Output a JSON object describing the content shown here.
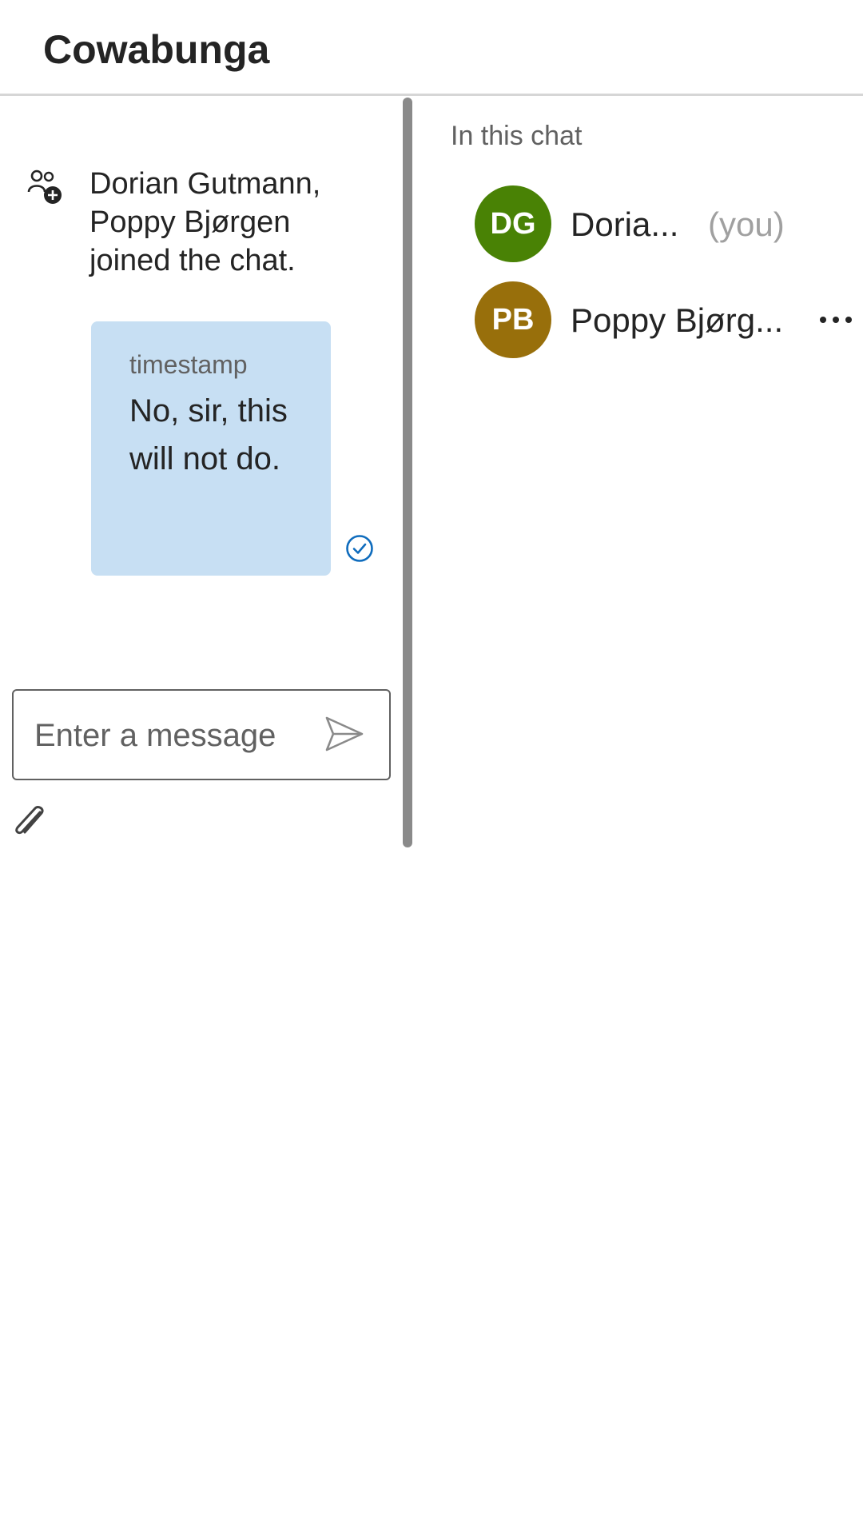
{
  "header": {
    "title": "Cowabunga"
  },
  "chat": {
    "system_message": "Dorian Gutmann, Poppy Bjørgen joined the chat.",
    "messages": [
      {
        "timestamp": "timestamp",
        "text": "No, sir, this will not do.",
        "status": "read"
      }
    ],
    "composer": {
      "placeholder": "Enter a message",
      "value": ""
    }
  },
  "people": {
    "heading": "In this chat",
    "members": [
      {
        "initials": "DG",
        "name": "Doria...",
        "suffix": "(you)",
        "avatar_color": "#498205"
      },
      {
        "initials": "PB",
        "name": "Poppy Bjørg...",
        "suffix": "",
        "avatar_color": "#986f0b"
      }
    ]
  },
  "colors": {
    "bubble": "#c7dff3",
    "read_receipt": "#0f6cbd",
    "divider": "#8a8a8a"
  },
  "icons": {
    "system": "people-add-icon",
    "read_receipt": "check-circle-icon",
    "send": "send-icon",
    "attach": "paperclip-icon",
    "more": "more-horizontal-icon"
  }
}
